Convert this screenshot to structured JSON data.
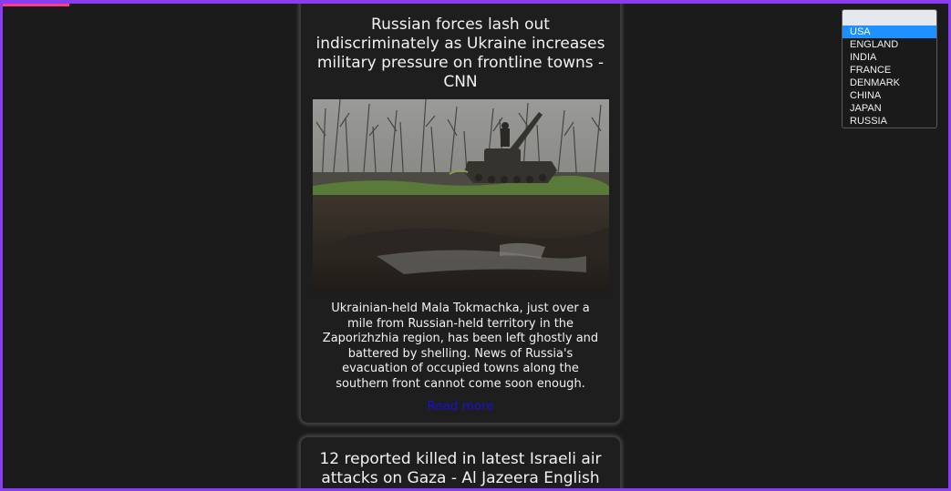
{
  "articles": [
    {
      "headline": "Russian forces lash out indiscriminately as Ukraine increases military pressure on frontline towns - CNN",
      "description": "Ukrainian-held Mala Tokmachka, just over a mile from Russian-held territory in the Zaporizhzhia region, has been left ghostly and battered by shelling. News of Russia's evacuation of occupied towns along the southern front cannot come soon enough.",
      "read_more": "Read more"
    },
    {
      "headline": "12 reported killed in latest Israeli air attacks on Gaza - Al Jazeera English"
    }
  ],
  "country_select": {
    "selected": "USA",
    "options": [
      "USA",
      "ENGLAND",
      "INDIA",
      "FRANCE",
      "DENMARK",
      "CHINA",
      "JAPAN",
      "RUSSIA"
    ]
  },
  "colors": {
    "frame_border": "#8a3df0",
    "background": "#1b1b1b",
    "link": "#1a0fd8",
    "selected_option": "#1e90ff"
  }
}
